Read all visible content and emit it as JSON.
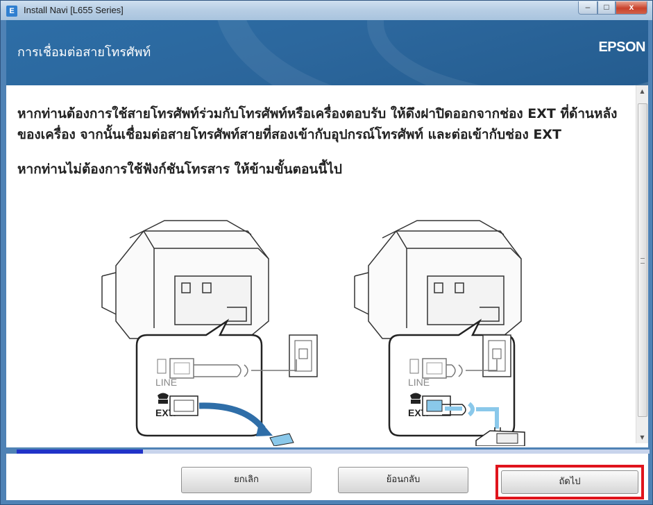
{
  "window": {
    "title": "Install Navi [L655 Series]",
    "controls": {
      "minimize": "–",
      "maximize": "□",
      "close": "x"
    }
  },
  "header": {
    "title": "การเชื่อมต่อสายโทรศัพท์",
    "brand": "EPSON"
  },
  "content": {
    "paragraph1": "หากท่านต้องการใช้สายโทรศัพท์ร่วมกับโทรศัพท์หรือเครื่องตอบรับ ให้ดึงฝาปิดออกจากช่อง EXT ที่ด้านหลังของเครื่อง จากนั้นเชื่อมต่อสายโทรศัพท์สายที่สองเข้ากับอุปกรณ์โทรศัพท์ และต่อเข้ากับช่อง EXT",
    "paragraph2": "หากท่านไม่ต้องการใช้ฟังก์ชันโทรสาร ให้ข้ามขั้นตอนนี้ไป",
    "illustrations": [
      {
        "port_line": "LINE",
        "port_ext": "EXT."
      },
      {
        "port_line": "LINE",
        "port_ext": "EXT."
      }
    ]
  },
  "progress": {
    "fraction": 0.2
  },
  "footer": {
    "cancel_label": "ยกเลิก",
    "back_label": "ย้อนกลับ",
    "next_label": "ถัดไป"
  },
  "colors": {
    "header_bg": "#2c679d",
    "progress_fill": "#2033c8",
    "highlight": "#e0141c",
    "cable": "#8ac8ea"
  }
}
